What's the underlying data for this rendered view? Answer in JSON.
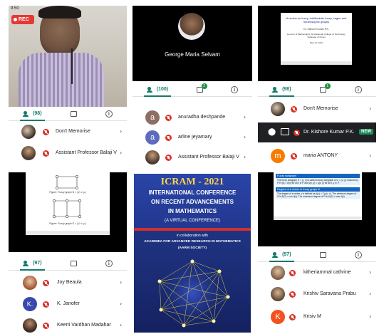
{
  "status_time": "9:50",
  "rec_label": "REC",
  "colors": {
    "accent": "#127a6a",
    "mute": "#d93025",
    "badge": "#1e8e3e",
    "new_badge": "#1a8a5a"
  },
  "panels": {
    "p1": {
      "count": "(98)",
      "rows": [
        {
          "name": "Don't Memorise"
        },
        {
          "name": "Assistant Professor Balaji V"
        }
      ]
    },
    "p2": {
      "speaker": "George Maria Selvam",
      "count": "(100)",
      "chat_badge": "2",
      "rows": [
        {
          "name": "anuradha deshpande",
          "letter": "a"
        },
        {
          "name": "arline jeyamary",
          "letter": "a"
        },
        {
          "name": "Assistant Professor Balaji V"
        }
      ]
    },
    "p3": {
      "slide_title": "A review on fuzzy, intuitionistic fuzzy, vague and neutrosophic graphs",
      "slide_author": "Dr. Kishore Kumar P.K.",
      "slide_affil": "Lecturer of Mathematics, Al-Musannah College of Technology, Sultanate of Oman",
      "slide_date": "May 19, 2021",
      "count": "(98)",
      "chat_badge": "1",
      "rows": [
        {
          "name": "Don't Memorise"
        },
        {
          "name": "Dr. Kishore Kumar P.K.",
          "badge": "NEW"
        },
        {
          "name": "maria ANTONY",
          "letter": "m"
        }
      ]
    },
    "p4": {
      "cap1": "Figure: Fuzzy graph G = (V, σ, μ)",
      "cap2": "Figure: Fuzzy graph G = (V, σ, μ)",
      "count": "(97)",
      "rows": [
        {
          "name": "Joy Beaula"
        },
        {
          "name": "K. Janofer",
          "letter": "K."
        },
        {
          "name": "Keerti Vardhan Madahar"
        }
      ]
    },
    "p5": {
      "line1": "ICRAM - 2021",
      "line2": "INTERNATIONAL CONFERENCE",
      "line3": "ON RECENT ADVANCEMENTS",
      "line4": "IN MATHEMATICS",
      "line5": "(A VIRTUAL CONFERENCE)",
      "line6": "in collaboration with",
      "line7": "ACADEMIA FOR ADVANCED RESEARCH IN MATHEMATICS",
      "line8": "(AARM SOCIETY)"
    },
    "p6": {
      "h1": "Fuzzy subgraph",
      "t1": "The fuzzy subgraph H = (τ, ν) is called a fuzzy subgraph of G = (σ, μ) induced by P if τ(x) = σ(x) for all x ∈ P and ν(x, y) = μ(x, y) for all x, y ∈ P.",
      "h2": "Degree of a vertex in fuzzy graph G",
      "t2": "The degree of a vertex u is defined as d(u) = Σ μ(u, v). The minimum degree of G is δ(G) = min d(v). The maximum degree of G is Δ(G) = max d(v).",
      "count": "(97)",
      "rows": [
        {
          "name": "kitheriammal cathrine"
        },
        {
          "name": "Krishiv Saravana Prabu"
        },
        {
          "name": "Krisiv M",
          "letter": "K"
        }
      ]
    }
  }
}
